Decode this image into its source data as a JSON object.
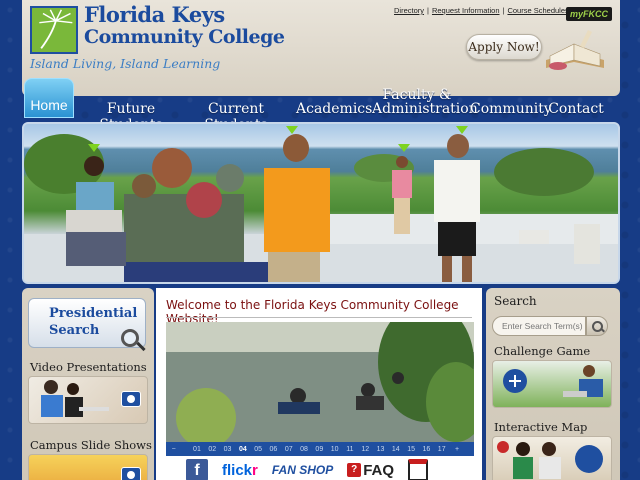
{
  "header": {
    "logo_line1": "Florida Keys",
    "logo_line2": "Community College",
    "tagline": "Island Living, Island Learning",
    "links": [
      "Directory",
      "Request Information",
      "Course Schedules"
    ],
    "myfkcc": "myFKCC",
    "apply_label": "Apply Now!"
  },
  "nav": {
    "home": "Home",
    "items": [
      "Future Students",
      "Current Students",
      "Academics",
      "Faculty &",
      "Administration",
      "Community",
      "Contact"
    ]
  },
  "left": {
    "pres_search_1": "Presidential",
    "pres_search_2": "Search",
    "video_heading": "Video Presentations",
    "slides_heading": "Campus Slide Shows"
  },
  "main": {
    "welcome": "Welcome to the Florida Keys Community College Website!",
    "pager_minus": "−",
    "pager_pages": [
      "01",
      "02",
      "03",
      "04",
      "05",
      "06",
      "07",
      "08",
      "09",
      "10",
      "11",
      "12",
      "13",
      "14",
      "15",
      "16",
      "17"
    ],
    "pager_current": "04",
    "pager_plus": "+",
    "social": {
      "facebook": "f",
      "flickr_a": "flick",
      "flickr_b": "r",
      "fanshop": "FAN SHOP",
      "faq_q": "?",
      "faq": "FAQ"
    }
  },
  "right": {
    "search_heading": "Search",
    "search_placeholder": "Enter Search Term(s)",
    "challenge_heading": "Challenge Game",
    "map_heading": "Interactive Map"
  },
  "colors": {
    "brand_blue": "#1b4b9e",
    "accent_green": "#7ab83a",
    "heading_red": "#7a1010"
  }
}
